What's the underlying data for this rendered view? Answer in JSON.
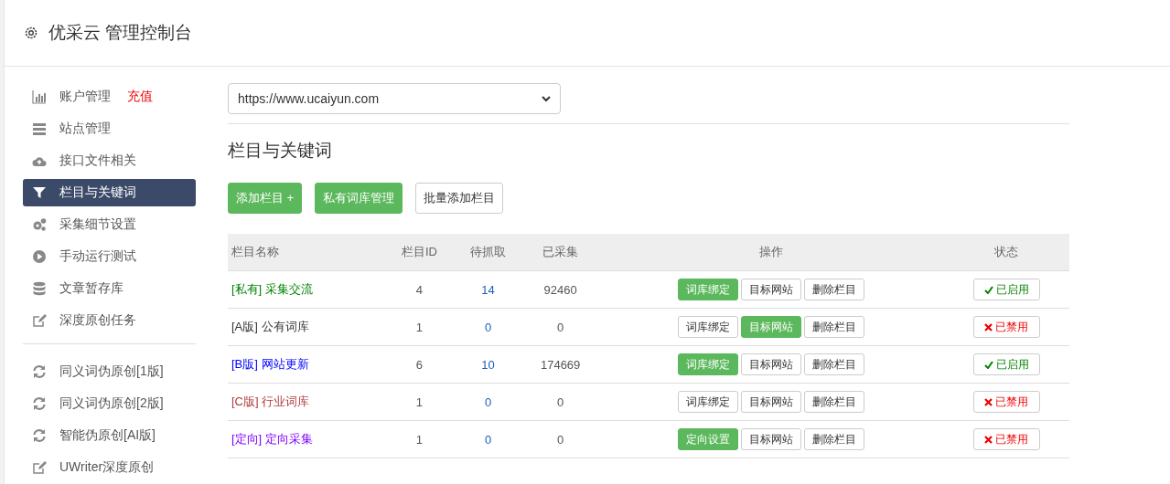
{
  "header": {
    "title": "优采云 管理控制台"
  },
  "sidebar": {
    "groups": [
      [
        {
          "kind": "chart",
          "label": "账户管理",
          "badge": "充值",
          "selected": false
        },
        {
          "kind": "server",
          "label": "站点管理",
          "selected": false
        },
        {
          "kind": "cloud",
          "label": "接口文件相关",
          "selected": false
        },
        {
          "kind": "filter",
          "label": "栏目与关键词",
          "selected": true
        },
        {
          "kind": "gears",
          "label": "采集细节设置",
          "selected": false
        },
        {
          "kind": "play",
          "label": "手动运行测试",
          "selected": false
        },
        {
          "kind": "database",
          "label": "文章暂存库",
          "selected": false
        },
        {
          "kind": "edit",
          "label": "深度原创任务",
          "selected": false
        }
      ],
      [
        {
          "kind": "refresh",
          "label": "同义词伪原创[1版]",
          "selected": false
        },
        {
          "kind": "refresh",
          "label": "同义词伪原创[2版]",
          "selected": false
        },
        {
          "kind": "refresh",
          "label": "智能伪原创[AI版]",
          "selected": false
        },
        {
          "kind": "edit",
          "label": "UWriter深度原创",
          "selected": false
        }
      ]
    ]
  },
  "site_select": {
    "value": "https://www.ucaiyun.com"
  },
  "section_title": "栏目与关键词",
  "toolbar": [
    {
      "label": "添加栏目 +",
      "primary": true
    },
    {
      "label": "私有词库管理",
      "primary": true
    },
    {
      "label": "批量添加栏目",
      "primary": false
    }
  ],
  "table": {
    "columns": [
      "栏目名称",
      "栏目ID",
      "待抓取",
      "已采集",
      "操作",
      "状态"
    ],
    "rows": [
      {
        "name": "[私有] 采集交流",
        "color": "#008000",
        "id": "4",
        "pending": "14",
        "collected": "92460",
        "actions": [
          {
            "label": "词库绑定",
            "primary": true
          },
          {
            "label": "目标网站",
            "primary": false
          },
          {
            "label": "删除栏目",
            "primary": false
          }
        ],
        "status": "已启用",
        "enabled": true
      },
      {
        "name": "[A版] 公有词库",
        "color": "#333333",
        "id": "1",
        "pending": "0",
        "collected": "0",
        "actions": [
          {
            "label": "词库绑定",
            "primary": false
          },
          {
            "label": "目标网站",
            "primary": true
          },
          {
            "label": "删除栏目",
            "primary": false
          }
        ],
        "status": "已禁用",
        "enabled": false
      },
      {
        "name": "[B版] 网站更新",
        "color": "#0000ff",
        "id": "6",
        "pending": "10",
        "collected": "174669",
        "actions": [
          {
            "label": "词库绑定",
            "primary": true
          },
          {
            "label": "目标网站",
            "primary": false
          },
          {
            "label": "删除栏目",
            "primary": false
          }
        ],
        "status": "已启用",
        "enabled": true
      },
      {
        "name": "[C版] 行业词库",
        "color": "#b03a3a",
        "id": "1",
        "pending": "0",
        "collected": "0",
        "actions": [
          {
            "label": "词库绑定",
            "primary": false
          },
          {
            "label": "目标网站",
            "primary": false
          },
          {
            "label": "删除栏目",
            "primary": false
          }
        ],
        "status": "已禁用",
        "enabled": false
      },
      {
        "name": "[定向] 定向采集",
        "color": "#8000ff",
        "id": "1",
        "pending": "0",
        "collected": "0",
        "actions": [
          {
            "label": "定向设置",
            "primary": true
          },
          {
            "label": "目标网站",
            "primary": false
          },
          {
            "label": "删除栏目",
            "primary": false
          }
        ],
        "status": "已禁用",
        "enabled": false
      }
    ]
  }
}
